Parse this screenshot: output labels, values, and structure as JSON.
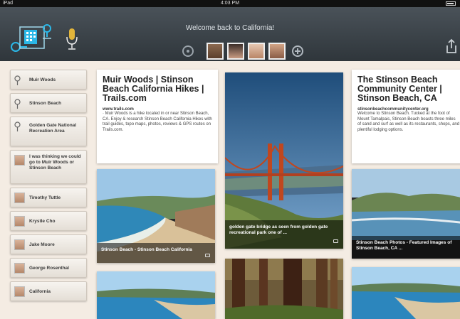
{
  "status": {
    "left": "iPad",
    "time": "4:03 PM"
  },
  "header": {
    "welcome": "Welcome back to California!"
  },
  "sidebar": {
    "items": [
      {
        "label": "Muir Woods",
        "icon": "map-pin-icon"
      },
      {
        "label": "Stinson Beach",
        "icon": "map-pin-icon"
      },
      {
        "label": "Golden Gate National Recreation Area",
        "icon": "map-pin-icon"
      },
      {
        "label": "I was thinking we could go to Muir Woods or Stinson Beach",
        "icon": "user-avatar-icon"
      },
      {
        "label": "Timothy Tuttle",
        "icon": "user-avatar-icon"
      },
      {
        "label": "Krystle Cho",
        "icon": "user-avatar-icon"
      },
      {
        "label": "Jake Moore",
        "icon": "user-avatar-icon"
      },
      {
        "label": "George Rosenthal",
        "icon": "user-avatar-icon"
      },
      {
        "label": "California",
        "icon": "user-avatar-icon"
      }
    ]
  },
  "cards": {
    "muir": {
      "title": "Muir Woods | Stinson Beach California Hikes | Trails.com",
      "source": "www.trails.com",
      "snippet": "· Muir Woods is a hike located in or near Stinson Beach, CA. Enjoy & research Stinson Beach California Hikes with trail guides, topo maps, photos, reviews & GPS routes on Trails.com."
    },
    "community": {
      "title": "The Stinson Beach Community Center | Stinson Beach, CA",
      "source": "stinsonbeachcommunitycenter.org",
      "snippet": "Welcome to Stinson Beach. Tucked at the foot of Mount Tamalpais, Stinson Beach boasts three miles of sand and surf as well as its restaurants, shops, and plentiful lodging options."
    },
    "photo_stinson": {
      "caption": "Stinson Beach - Stinson Beach California"
    },
    "photo_bridge": {
      "caption": "golden gate bridge as seen from golden gate recreational park one of ..."
    },
    "photo_featured": {
      "caption": "Stinson Beach Photos - Featured Images of Stinson Beach, CA ..."
    }
  },
  "colors": {
    "header": "#3b4349",
    "background": "#f4ece3",
    "accent": "#2bb8e8"
  }
}
